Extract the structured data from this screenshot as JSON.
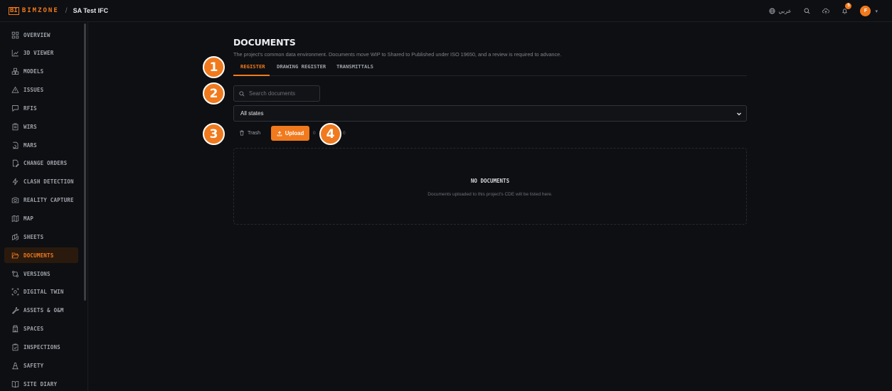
{
  "topbar": {
    "logo_mark": "BI",
    "logo_text": "BIMZONE",
    "separator": "/",
    "project_name": "SA Test IFC",
    "language_label": "عربي",
    "notification_count": "5",
    "avatar_initial": "F"
  },
  "sidebar": {
    "items": [
      {
        "label": "OVERVIEW",
        "icon": "grid-icon"
      },
      {
        "label": "3D VIEWER",
        "icon": "chart-icon"
      },
      {
        "label": "MODELS",
        "icon": "boxes-icon"
      },
      {
        "label": "ISSUES",
        "icon": "warning-icon"
      },
      {
        "label": "RFIS",
        "icon": "message-icon"
      },
      {
        "label": "WIRS",
        "icon": "clipboard-icon"
      },
      {
        "label": "MARS",
        "icon": "file-refresh-icon"
      },
      {
        "label": "CHANGE ORDERS",
        "icon": "file-edit-icon"
      },
      {
        "label": "CLASH DETECTION",
        "icon": "lightning-icon"
      },
      {
        "label": "REALITY CAPTURE",
        "icon": "camera-icon"
      },
      {
        "label": "MAP",
        "icon": "map-icon"
      },
      {
        "label": "SHEETS",
        "icon": "sheets-icon"
      },
      {
        "label": "DOCUMENTS",
        "icon": "folder-open-icon"
      },
      {
        "label": "VERSIONS",
        "icon": "git-compare-icon"
      },
      {
        "label": "DIGITAL TWIN",
        "icon": "scan-icon"
      },
      {
        "label": "ASSETS & O&M",
        "icon": "wrench-icon"
      },
      {
        "label": "SPACES",
        "icon": "building-icon"
      },
      {
        "label": "INSPECTIONS",
        "icon": "clipboard-check-icon"
      },
      {
        "label": "SAFETY",
        "icon": "cone-icon"
      },
      {
        "label": "SITE DIARY",
        "icon": "book-icon"
      }
    ],
    "active_index": 12
  },
  "main": {
    "title": "DOCUMENTS",
    "subtitle": "The project's common data environment. Documents move WIP to Shared to Published under ISO 19650, and a review is required to advance.",
    "tabs": [
      {
        "label": "REGISTER"
      },
      {
        "label": "DRAWING REGISTER"
      },
      {
        "label": "TRANSMITTALS"
      }
    ],
    "search_placeholder": "Search documents",
    "state_filter": "All states",
    "trash_label": "Trash",
    "upload_label": "Upload",
    "count_left": "0",
    "count_right": "0",
    "empty_title": "NO DOCUMENTS",
    "empty_desc": "Documents uploaded to this project's CDE will be listed here."
  },
  "markers": [
    "1",
    "2",
    "3",
    "4"
  ],
  "colors": {
    "accent": "#f07a1d",
    "background": "#0e0f12",
    "border": "#30333a"
  }
}
